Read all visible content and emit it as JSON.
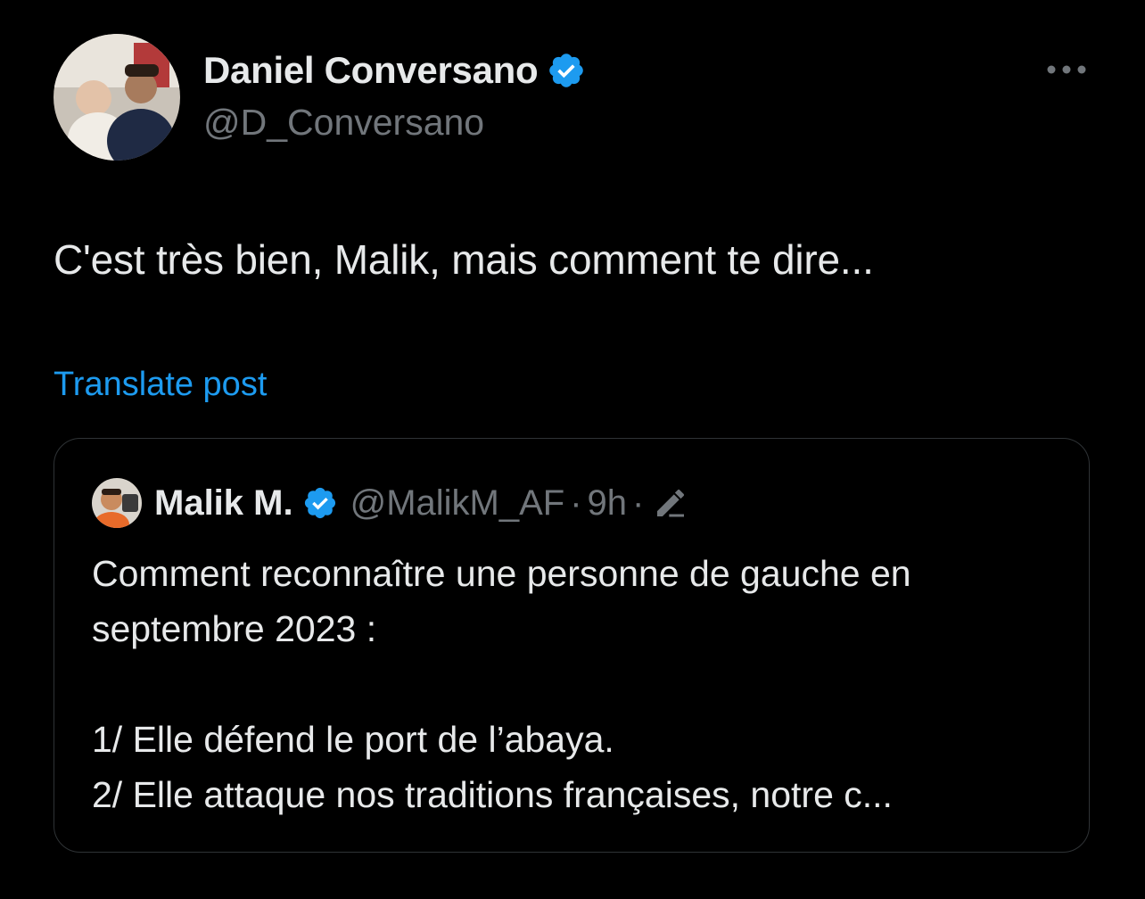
{
  "post": {
    "author": {
      "name": "Daniel Conversano",
      "handle": "@D_Conversano",
      "verified": true,
      "avatar_icon": "profile-photo"
    },
    "text": "C'est très bien, Malik, mais comment te dire...",
    "translate_label": "Translate post",
    "more_icon": "more-horizontal-icon"
  },
  "quote": {
    "author": {
      "name": "Malik M.",
      "handle": "@MalikM_AF",
      "verified": true,
      "avatar_icon": "profile-photo"
    },
    "separator": "·",
    "time": "9h",
    "edited_icon": "edit-pencil-icon",
    "lines": [
      "Comment reconnaître une personne de gauche en",
      "septembre 2023 :",
      "",
      "1/ Elle défend le port de l’abaya.",
      "2/ Elle attaque nos traditions françaises, notre c..."
    ]
  },
  "colors": {
    "background": "#000000",
    "text_primary": "#e7e9ea",
    "text_secondary": "#71767b",
    "accent": "#1d9bf0",
    "border": "#2f3336"
  }
}
